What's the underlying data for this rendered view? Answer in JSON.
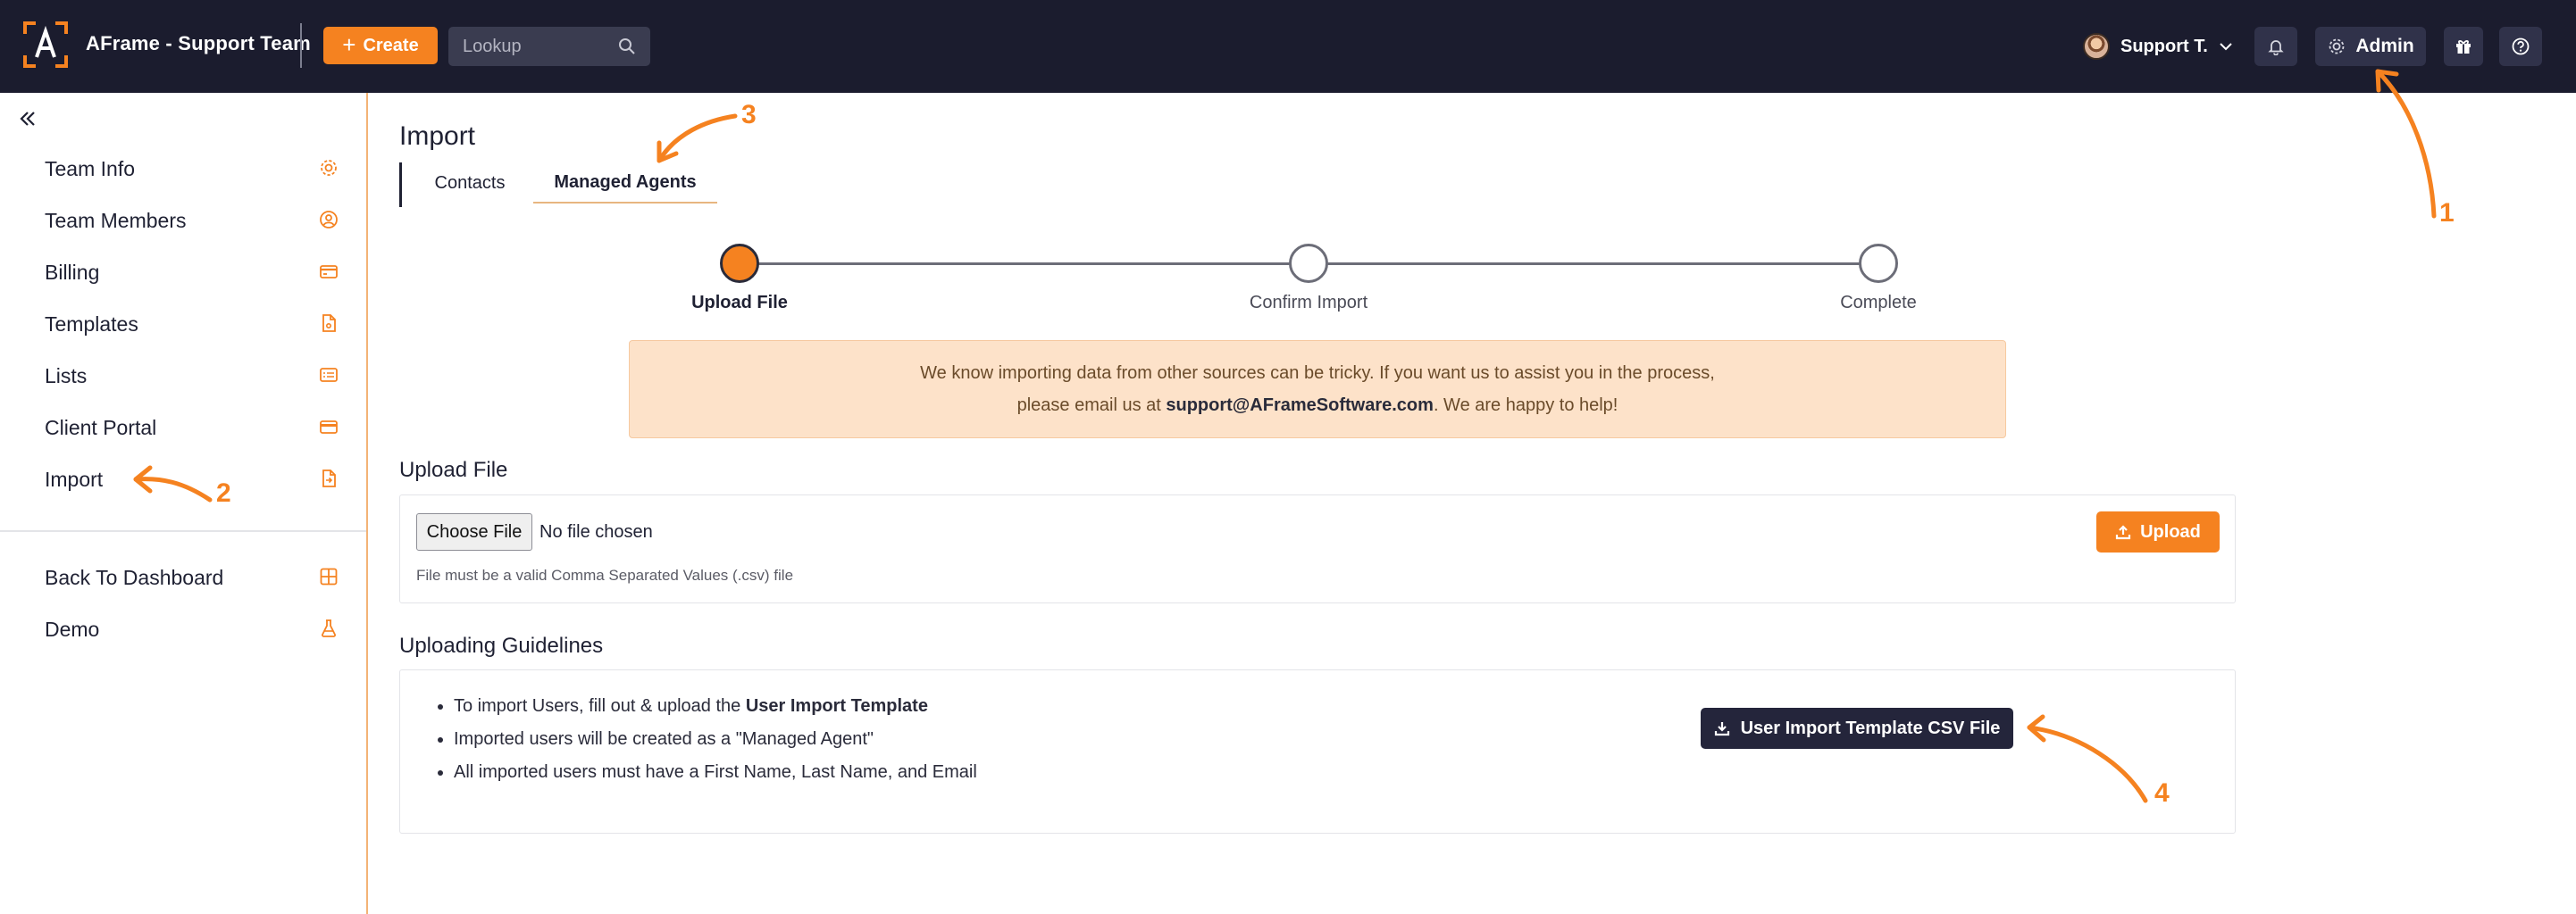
{
  "header": {
    "app_title": "AFrame - Support Team",
    "create_label": "Create",
    "lookup_placeholder": "Lookup",
    "user_name": "Support T.",
    "admin_label": "Admin"
  },
  "sidebar": {
    "items": [
      {
        "label": "Team Info",
        "icon": "gear-icon"
      },
      {
        "label": "Team Members",
        "icon": "user-circle-icon"
      },
      {
        "label": "Billing",
        "icon": "credit-card-icon"
      },
      {
        "label": "Templates",
        "icon": "document-icon"
      },
      {
        "label": "Lists",
        "icon": "list-icon"
      },
      {
        "label": "Client Portal",
        "icon": "portal-card-icon"
      },
      {
        "label": "Import",
        "icon": "file-import-icon"
      }
    ],
    "bottom_items": [
      {
        "label": "Back To Dashboard",
        "icon": "grid-icon"
      },
      {
        "label": "Demo",
        "icon": "flask-icon"
      }
    ]
  },
  "main": {
    "title": "Import",
    "tabs": [
      {
        "label": "Contacts",
        "active": false
      },
      {
        "label": "Managed Agents",
        "active": true
      }
    ],
    "steps": [
      {
        "label": "Upload File",
        "active": true
      },
      {
        "label": "Confirm Import",
        "active": false
      },
      {
        "label": "Complete",
        "active": false
      }
    ],
    "notice": {
      "line1": "We know importing data from other sources can be tricky. If you want us to assist you in the process,",
      "line2_prefix": "please email us at ",
      "email": "support@AFrameSoftware.com",
      "line2_suffix": ". We are happy to help!"
    },
    "upload": {
      "title": "Upload File",
      "choose_label": "Choose File",
      "no_file": "No file chosen",
      "help": "File must be a valid Comma Separated Values (.csv) file",
      "upload_label": "Upload"
    },
    "guidelines": {
      "title": "Uploading Guidelines",
      "item1_prefix": "To import Users, fill out & upload the ",
      "item1_bold": "User Import Template",
      "item2": "Imported users will be created as a \"Managed Agent\"",
      "item3": "All imported users must have a First Name, Last Name, and Email",
      "template_button": "User Import Template CSV File"
    }
  },
  "annotations": [
    "1",
    "2",
    "3",
    "4"
  ],
  "colors": {
    "nav_bg": "#1b1c2e",
    "accent": "#f58220",
    "notice_bg": "#fde2c9",
    "dark_button": "#24253b"
  }
}
